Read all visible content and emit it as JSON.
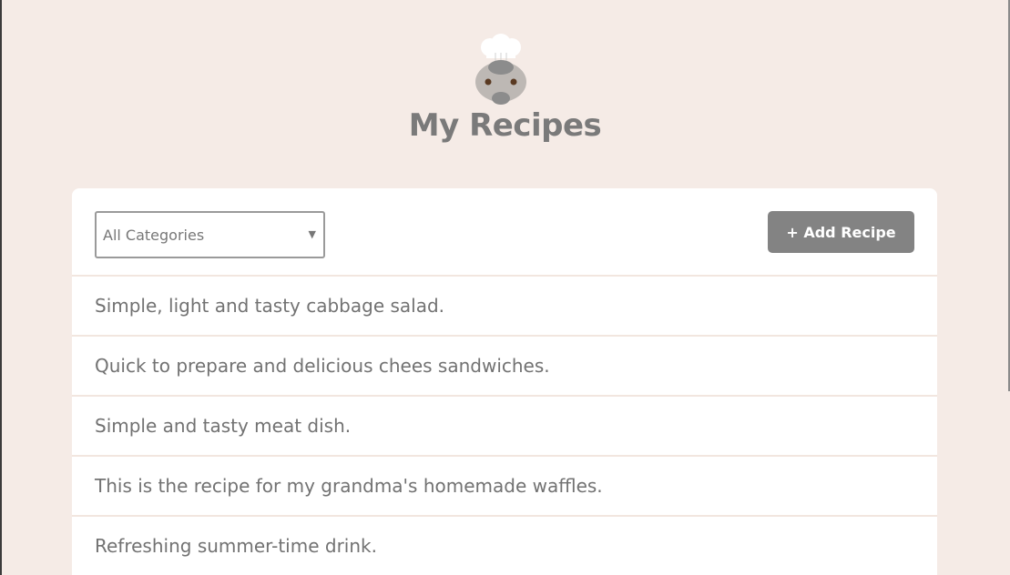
{
  "header": {
    "title": "My Recipes",
    "logo_icon": "chef-hat-mascot-icon"
  },
  "filter": {
    "selected": "All Categories",
    "arrow": "▼"
  },
  "toolbar": {
    "add_label": "+ Add Recipe"
  },
  "recipes": [
    {
      "description": "Simple, light and tasty cabbage salad."
    },
    {
      "description": "Quick to prepare and delicious chees sandwiches."
    },
    {
      "description": "Simple and tasty meat dish."
    },
    {
      "description": "This is the recipe for my grandma's homemade waffles."
    },
    {
      "description": "Refreshing summer-time drink."
    }
  ],
  "colors": {
    "background": "#f5ebe6",
    "card": "#ffffff",
    "button": "#838383",
    "text": "#727272",
    "divider": "#f2e6df"
  }
}
